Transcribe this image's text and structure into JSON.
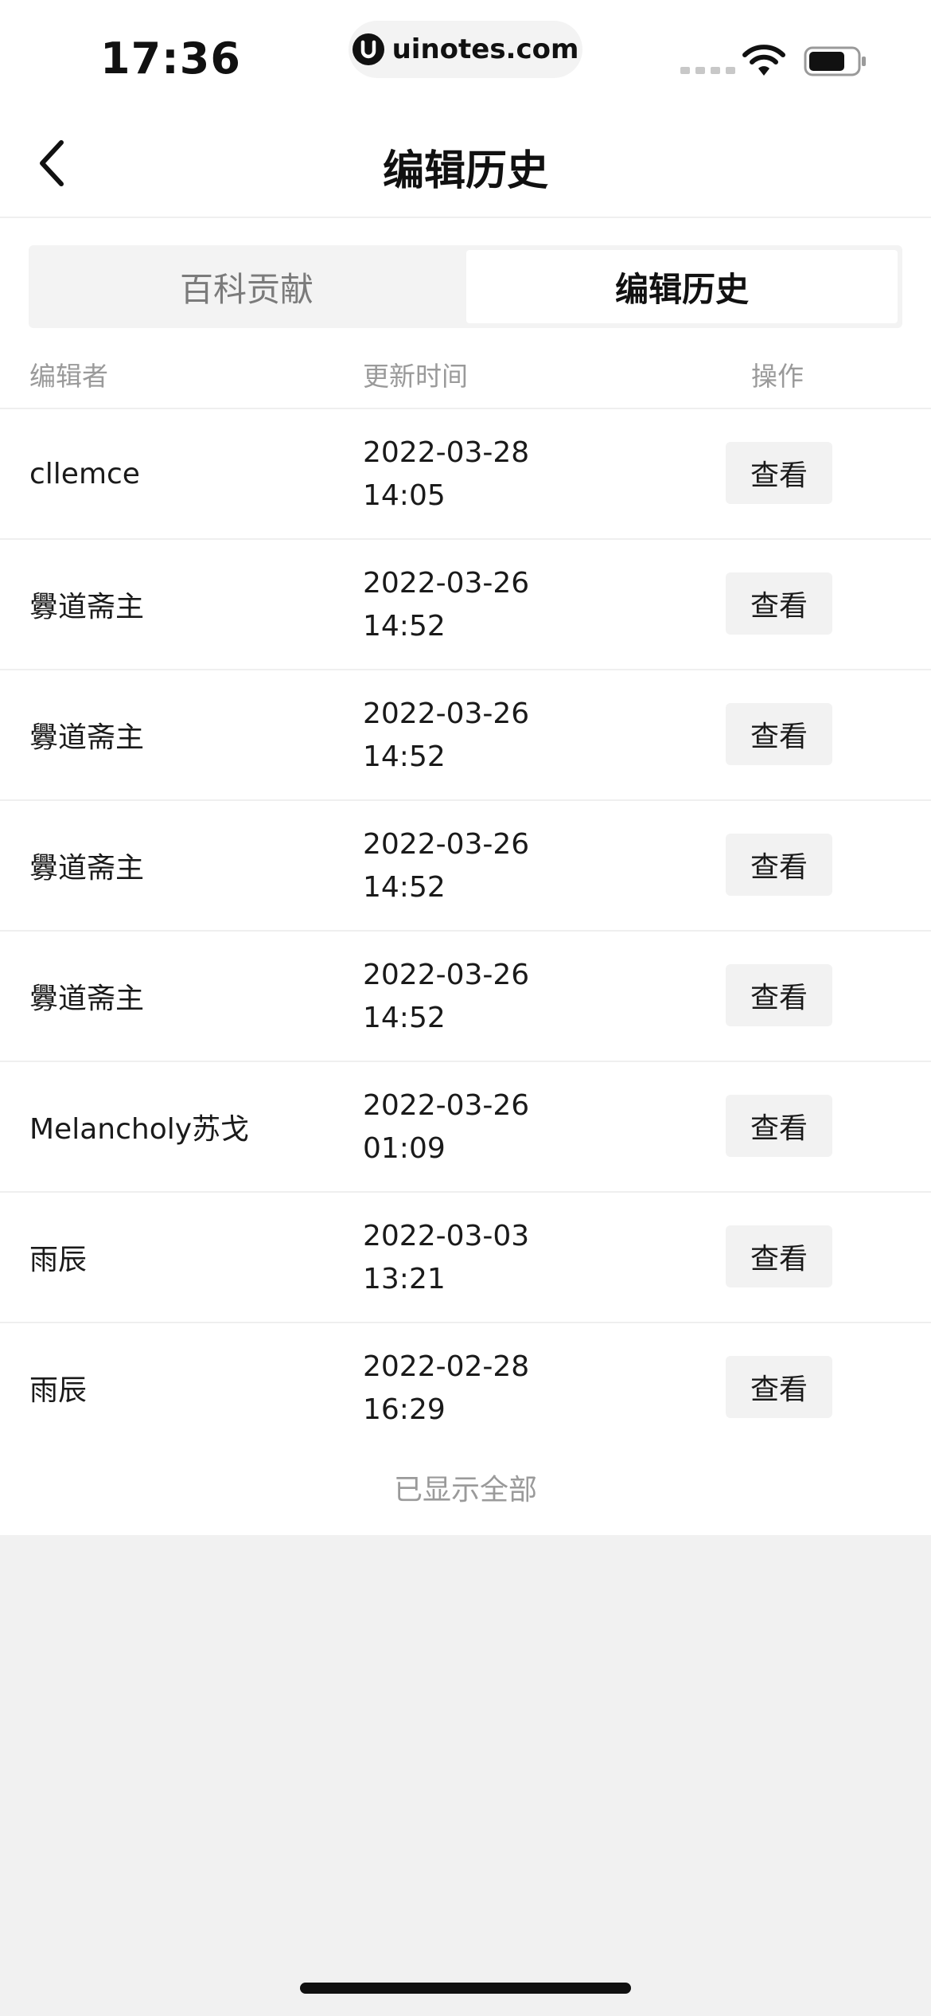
{
  "status_bar": {
    "time": "17:36",
    "url": "uinotes.com",
    "icons": [
      "signal-icon",
      "wifi-icon",
      "battery-icon"
    ]
  },
  "nav": {
    "back_icon": "chevron-left-icon",
    "title": "编辑历史"
  },
  "tabs": [
    {
      "label": "百科贡献",
      "active": false
    },
    {
      "label": "编辑历史",
      "active": true
    }
  ],
  "table": {
    "headers": [
      "编辑者",
      "更新时间",
      "操作"
    ],
    "rows": [
      {
        "editor": "cllemce",
        "date": "2022-03-28",
        "time": "14:05",
        "action": "查看"
      },
      {
        "editor": "釁道斋主",
        "date": "2022-03-26",
        "time": "14:52",
        "action": "查看"
      },
      {
        "editor": "釁道斋主",
        "date": "2022-03-26",
        "time": "14:52",
        "action": "查看"
      },
      {
        "editor": "釁道斋主",
        "date": "2022-03-26",
        "time": "14:52",
        "action": "查看"
      },
      {
        "editor": "釁道斋主",
        "date": "2022-03-26",
        "time": "14:52",
        "action": "查看"
      },
      {
        "editor": "Melancholy苏戈",
        "date": "2022-03-26",
        "time": "01:09",
        "action": "查看"
      },
      {
        "editor": "雨辰",
        "date": "2022-03-03",
        "time": "13:21",
        "action": "查看"
      },
      {
        "editor": "雨辰",
        "date": "2022-02-28",
        "time": "16:29",
        "action": "查看"
      }
    ]
  },
  "footer": {
    "text": "已显示全部"
  },
  "colors": {
    "background": "#f1f1f1",
    "surface": "#ffffff",
    "text_primary": "#1a1a1a",
    "text_secondary": "#9a9a9a",
    "button_bg": "#f2f2f2"
  }
}
